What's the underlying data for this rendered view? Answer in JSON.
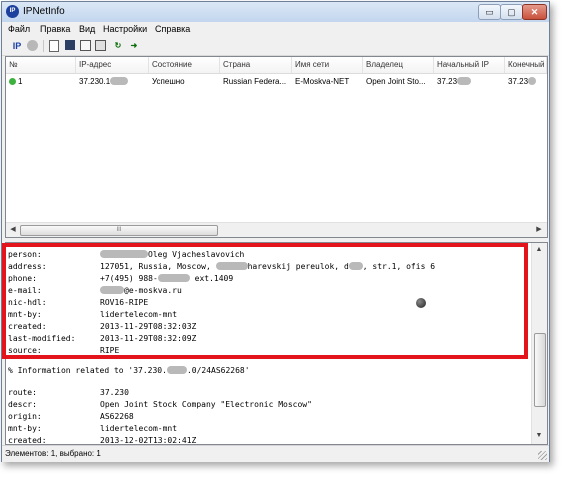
{
  "window": {
    "title": "IPNetInfo",
    "icon": "IP"
  },
  "window_controls": {
    "minimize": "▭",
    "maximize": "▢",
    "close": "✕"
  },
  "menu": [
    "Файл",
    "Правка",
    "Вид",
    "Настройки",
    "Справка"
  ],
  "toolbar": [
    "ip-icon",
    "globe-icon",
    "document-icon",
    "save-icon",
    "copy-icon",
    "options-icon",
    "refresh-icon",
    "exit-icon"
  ],
  "toolbar_labels": {
    "ip": "IP"
  },
  "table": {
    "columns": [
      "№",
      "IP-адрес",
      "Состояние",
      "Страна",
      "Имя сети",
      "Владелец",
      "Начальный IP",
      "Конечный"
    ],
    "rows": [
      {
        "num": "1",
        "ip": "37.230.1",
        "status": "Успешно",
        "country": "Russian Federa...",
        "network": "E-Moskva-NET",
        "owner": "Open Joint Sto...",
        "start_ip": "37.23",
        "end_ip": "37.23",
        "status_color": "#3db13d"
      }
    ],
    "hscroll_label": "III"
  },
  "whois": {
    "block1": [
      {
        "key": "person:",
        "value": "Oleg Vjacheslavovich"
      },
      {
        "key": "address:",
        "value": "127051, Russia, Moscow,",
        "value2": "harevskij pereulok, d",
        "value3": ", str.1, ofis 6"
      },
      {
        "key": "phone:",
        "value": "+7(495) 988-",
        "value2": "ext.1409"
      },
      {
        "key": "e-mail:",
        "value": "@e-moskva.ru"
      },
      {
        "key": "nic-hdl:",
        "value": "ROV16-RIPE"
      },
      {
        "key": "mnt-by:",
        "value": "lidertelecom-mnt"
      },
      {
        "key": "created:",
        "value": "2013-11-29T08:32:03Z"
      },
      {
        "key": "last-modified:",
        "value": "2013-11-29T08:32:09Z"
      },
      {
        "key": "source:",
        "value": "RIPE"
      }
    ],
    "info_line_a": "% Information related to '37.230.",
    "info_line_b": ".0/24AS62268'",
    "block2": [
      {
        "key": "route:",
        "value": "37.230"
      },
      {
        "key": "descr:",
        "value": "Open Joint Stock Company \"Electronic Moscow\""
      },
      {
        "key": "origin:",
        "value": "AS62268"
      },
      {
        "key": "mnt-by:",
        "value": "lidertelecom-mnt"
      },
      {
        "key": "created:",
        "value": "2013-12-02T13:02:41Z"
      }
    ]
  },
  "status_bar": "Элементов: 1, выбрано: 1",
  "colors": {
    "highlight": "#e3141c",
    "accent": "#1b3fa6"
  }
}
